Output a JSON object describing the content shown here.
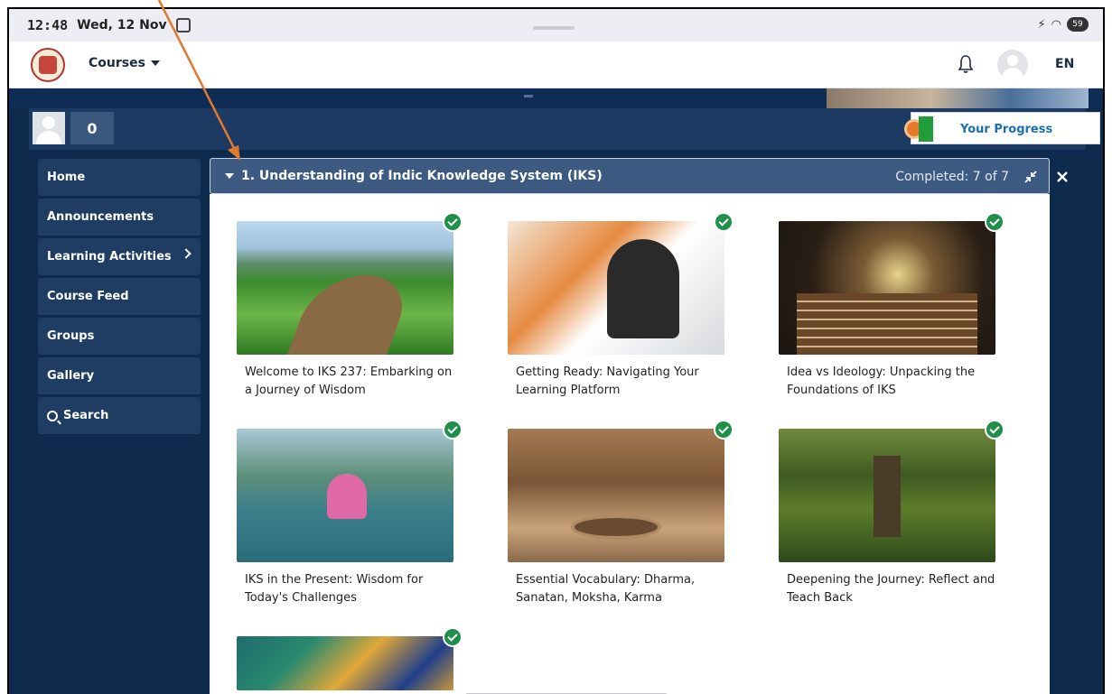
{
  "statusbar": {
    "time": "12:48",
    "date": "Wed, 12 Nov",
    "battery": "59"
  },
  "header": {
    "courses_label": "Courses",
    "language": "EN"
  },
  "userbar": {
    "points": "0",
    "progress_label": "Your Progress"
  },
  "sidebar": {
    "items": [
      {
        "label": "Home"
      },
      {
        "label": "Announcements"
      },
      {
        "label": "Learning Activities"
      },
      {
        "label": "Course Feed"
      },
      {
        "label": "Groups"
      },
      {
        "label": "Gallery"
      },
      {
        "label": "Search"
      }
    ]
  },
  "section": {
    "title": "1. Understanding of Indic Knowledge System (IKS)",
    "status": "Completed: 7 of 7"
  },
  "activities": [
    {
      "title": "Welcome to IKS 237: Embarking on a Journey of Wisdom"
    },
    {
      "title": "Getting Ready: Navigating Your Learning Platform"
    },
    {
      "title": "Idea vs Ideology: Unpacking the Foundations of IKS"
    },
    {
      "title": "IKS in the Present: Wisdom for Today's Challenges"
    },
    {
      "title": "Essential Vocabulary: Dharma, Sanatan, Moksha, Karma"
    },
    {
      "title": "Deepening the Journey: Reflect and Teach Back"
    },
    {
      "title": ""
    }
  ],
  "colors": {
    "navy": "#0e2a4d",
    "sidebar_item": "#1f3c63",
    "section_header": "#3d5a82",
    "complete_check": "#1f8f4a",
    "annotation_arrow": "#e0782e"
  }
}
